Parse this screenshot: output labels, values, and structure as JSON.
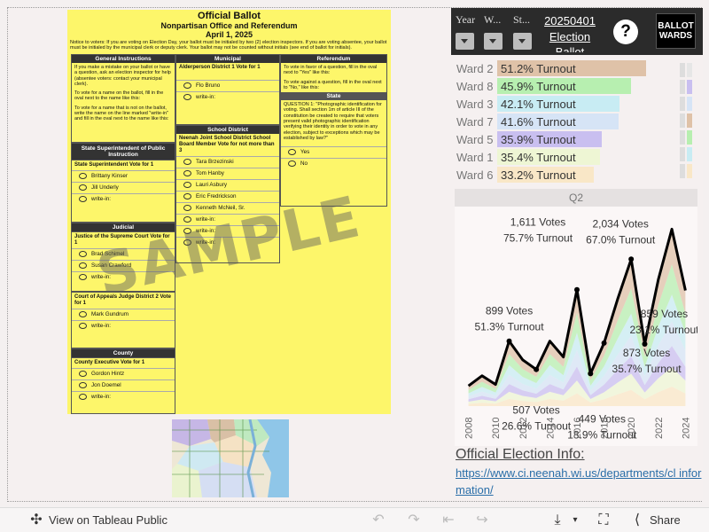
{
  "ballot": {
    "title": "Official Ballot",
    "subtitle": "Nonpartisan Office and Referendum",
    "date": "April 1, 2025",
    "notice": "Notice to voters: If you are voting on Election Day, your ballot must be initialed by two (2) election inspectors. If you are voting absentee, your ballot must be initialed by the municipal clerk or deputy clerk. Your ballot may not be counted without initials (see end of ballot for initials).",
    "watermark": "SAMPLE",
    "general": {
      "header": "General Instructions",
      "text1": "If you make a mistake on your ballot or have a question, ask an election inspector for help (absentee voters: contact your municipal clerk).",
      "text2": "To vote for a name on the ballot, fill in the oval next to the name like this:",
      "text3": "To vote for a name that is not on the ballot, write the name on the line marked \"write-in\" and fill in the oval next to the name like this:"
    },
    "state_super": {
      "header": "State Superintendent of Public Instruction",
      "race": "State Superintendent Vote for 1",
      "candidates": [
        "Brittany Kinser",
        "Jill Underly",
        "write-in:"
      ]
    },
    "judicial": {
      "header": "Judicial",
      "race": "Justice of the Supreme Court Vote for 1",
      "candidates": [
        "Brad Schimel",
        "Susan Crawford",
        "write-in:"
      ]
    },
    "appeals": {
      "race": "Court of Appeals Judge District 2 Vote for 1",
      "candidates": [
        "Mark Gundrum",
        "write-in:"
      ]
    },
    "county": {
      "header": "County",
      "race": "County Executive Vote for 1",
      "candidates": [
        "Gordon Hintz",
        "Jon Doemel",
        "write-in:"
      ]
    },
    "municipal": {
      "header": "Municipal",
      "race": "Alderperson District 1 Vote for 1",
      "candidates": [
        "Flo Bruno",
        "write-in:"
      ]
    },
    "school": {
      "header": "School District",
      "race": "Neenah Joint School District School Board Member Vote for not more than 3",
      "candidates": [
        "Tara Brzezinski",
        "Tom Hanby",
        "Lauri Asbury",
        "Eric Fredrickson",
        "Kenneth McNeil, Sr.",
        "write-in:",
        "write-in:",
        "write-in:"
      ]
    },
    "referendum": {
      "header": "Referendum",
      "text1": "To vote in favor of a question, fill in the oval next to \"Yes\" like this:",
      "text2": "To vote against a question, fill in the oval next to \"No,\" like this:",
      "state_header": "State",
      "question": "QUESTION 1: \"Photographic identification for voting. Shall section 1m of article III of the constitution be created to require that voters present valid photographic identification verifying their identity in order to vote in any election, subject to exceptions which may be established by law?\"",
      "options": [
        "Yes",
        "No"
      ]
    }
  },
  "filters": {
    "year": "Year",
    "ward": "W...",
    "status": "St...",
    "election_date": "20250401",
    "election_label": "Election",
    "ballot_label": "Ballot",
    "help": "?",
    "logo_top": "BALLOT",
    "logo_bottom": "WARDS"
  },
  "wards": [
    {
      "label": "Ward 2",
      "turnout": "51.2% Turnout",
      "pct": 51.2,
      "color": "#dfc2a8"
    },
    {
      "label": "Ward 8",
      "turnout": "45.9% Turnout",
      "pct": 45.9,
      "color": "#b7efb0"
    },
    {
      "label": "Ward 3",
      "turnout": "42.1% Turnout",
      "pct": 42.1,
      "color": "#c8ecf3"
    },
    {
      "label": "Ward 7",
      "turnout": "41.6% Turnout",
      "pct": 41.6,
      "color": "#d6e4f6"
    },
    {
      "label": "Ward 5",
      "turnout": "35.9% Turnout",
      "pct": 35.9,
      "color": "#c9bff0"
    },
    {
      "label": "Ward 1",
      "turnout": "35.4% Turnout",
      "pct": 35.4,
      "color": "#eef6d4"
    },
    {
      "label": "Ward 6",
      "turnout": "33.2% Turnout",
      "pct": 33.2,
      "color": "#f9e7c7"
    }
  ],
  "chart_data": {
    "type": "line",
    "title": "Q2",
    "xlabel": "",
    "ylabel": "",
    "x_ticks": [
      "2008",
      "2010",
      "2012",
      "2014",
      "2016",
      "2018",
      "2020",
      "2022",
      "2024"
    ],
    "series": [
      {
        "values": [
          [
            2008,
            280
          ],
          [
            2009,
            420
          ],
          [
            2010,
            300
          ],
          [
            2011,
            899
          ],
          [
            2012,
            640
          ],
          [
            2013,
            507
          ],
          [
            2014,
            900
          ],
          [
            2015,
            680
          ],
          [
            2016,
            1611
          ],
          [
            2017,
            449
          ],
          [
            2018,
            873
          ],
          [
            2019,
            1480
          ],
          [
            2020,
            2034
          ],
          [
            2021,
            859
          ],
          [
            2022,
            1750
          ],
          [
            2023,
            2450
          ],
          [
            2024,
            1600
          ]
        ]
      }
    ],
    "annotations": [
      {
        "x": 2011,
        "votes": "899 Votes",
        "turnout": "51.3% Turnout"
      },
      {
        "x": 2013,
        "votes": "507 Votes",
        "turnout": "26.6% Turnout"
      },
      {
        "x": 2016,
        "votes": "1,611 Votes",
        "turnout": "75.7% Turnout"
      },
      {
        "x": 2017,
        "votes": "449 Votes",
        "turnout": "18.9% Turnout"
      },
      {
        "x": 2018,
        "votes": "873 Votes",
        "turnout": "35.7% Turnout"
      },
      {
        "x": 2020,
        "votes": "2,034 Votes",
        "turnout": "67.0% Turnout"
      },
      {
        "x": 2021,
        "votes": "859 Votes",
        "turnout": "23.1% Turnout"
      }
    ],
    "ylim": [
      0,
      2700
    ],
    "xlim": [
      2007.5,
      2024.5
    ]
  },
  "info": {
    "title": "Official Election Info:",
    "url": "https://www.ci.neenah.wi.us/departments/clerk/election-information/",
    "url_display": "https://www.ci.neenah.wi.us/departments/cl information/"
  },
  "footer": {
    "view_label": "View on Tableau Public",
    "share_label": "Share"
  }
}
